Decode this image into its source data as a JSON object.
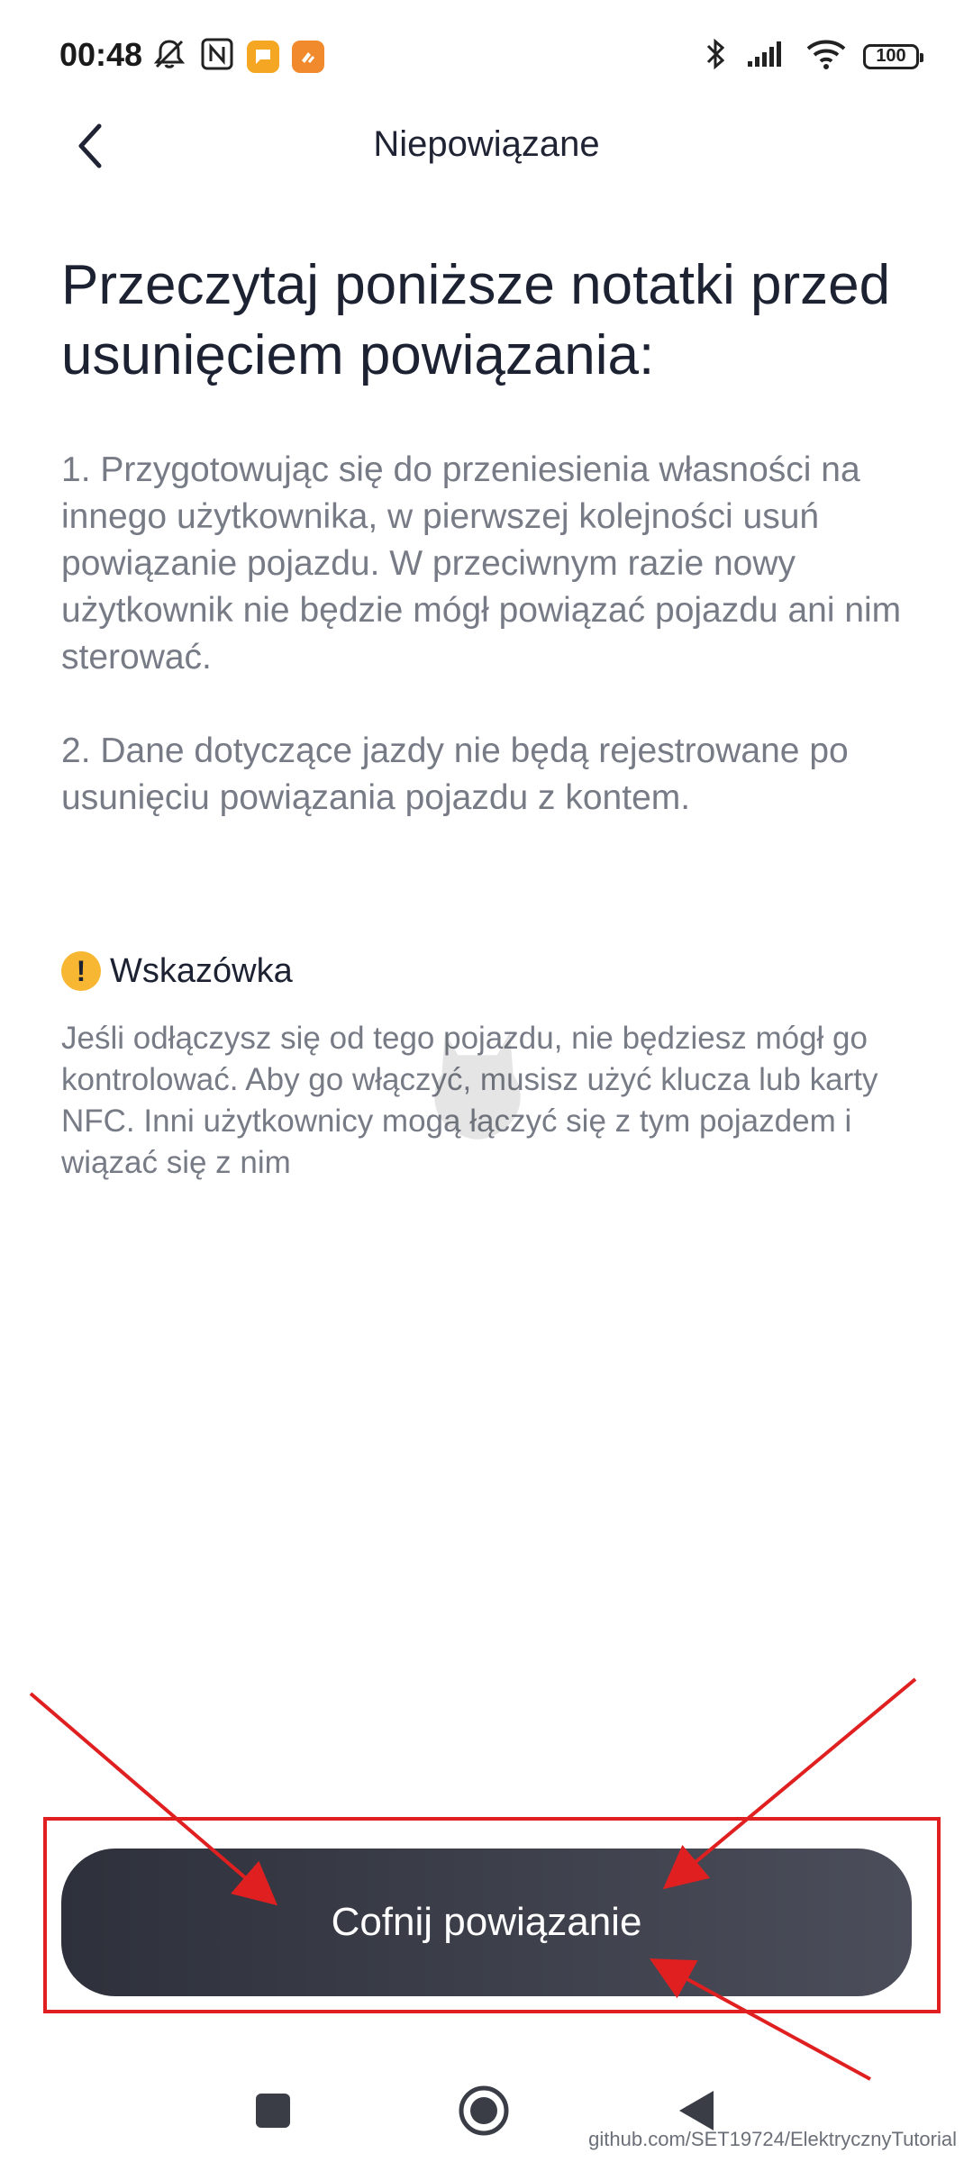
{
  "status_bar": {
    "time": "00:48",
    "battery": "100"
  },
  "header": {
    "title": "Niepowiązane"
  },
  "content": {
    "heading": "Przeczytaj poniższe notatki przed usunięciem powiązania:",
    "notes": [
      "1. Przygotowując się do przeniesienia własności na innego użytkownika, w pierwszej kolejności usuń powiązanie pojazdu. W przeciwnym razie nowy użytkownik nie będzie mógł powiązać pojazdu ani nim sterować.",
      "2. Dane dotyczące jazdy nie będą rejestrowane po usunięciu powiązania pojazdu z kontem."
    ],
    "tip_title": "Wskazówka",
    "tip_text": "Jeśli odłączysz się od tego pojazdu, nie będziesz mógł go kontrolować. Aby go włączyć, musisz użyć klucza lub karty NFC. Inni użytkownicy mogą łączyć się z tym pojazdem i wiązać się z nim",
    "tip_icon_glyph": "!"
  },
  "actions": {
    "unbind_label": "Cofnij powiązanie"
  },
  "footer": {
    "credit": "github.com/SET19724/ElektrycznyTutorial"
  },
  "colors": {
    "accent_tip": "#f7b733",
    "annotation_red": "#e02020",
    "button_dark": "#2e313b"
  }
}
